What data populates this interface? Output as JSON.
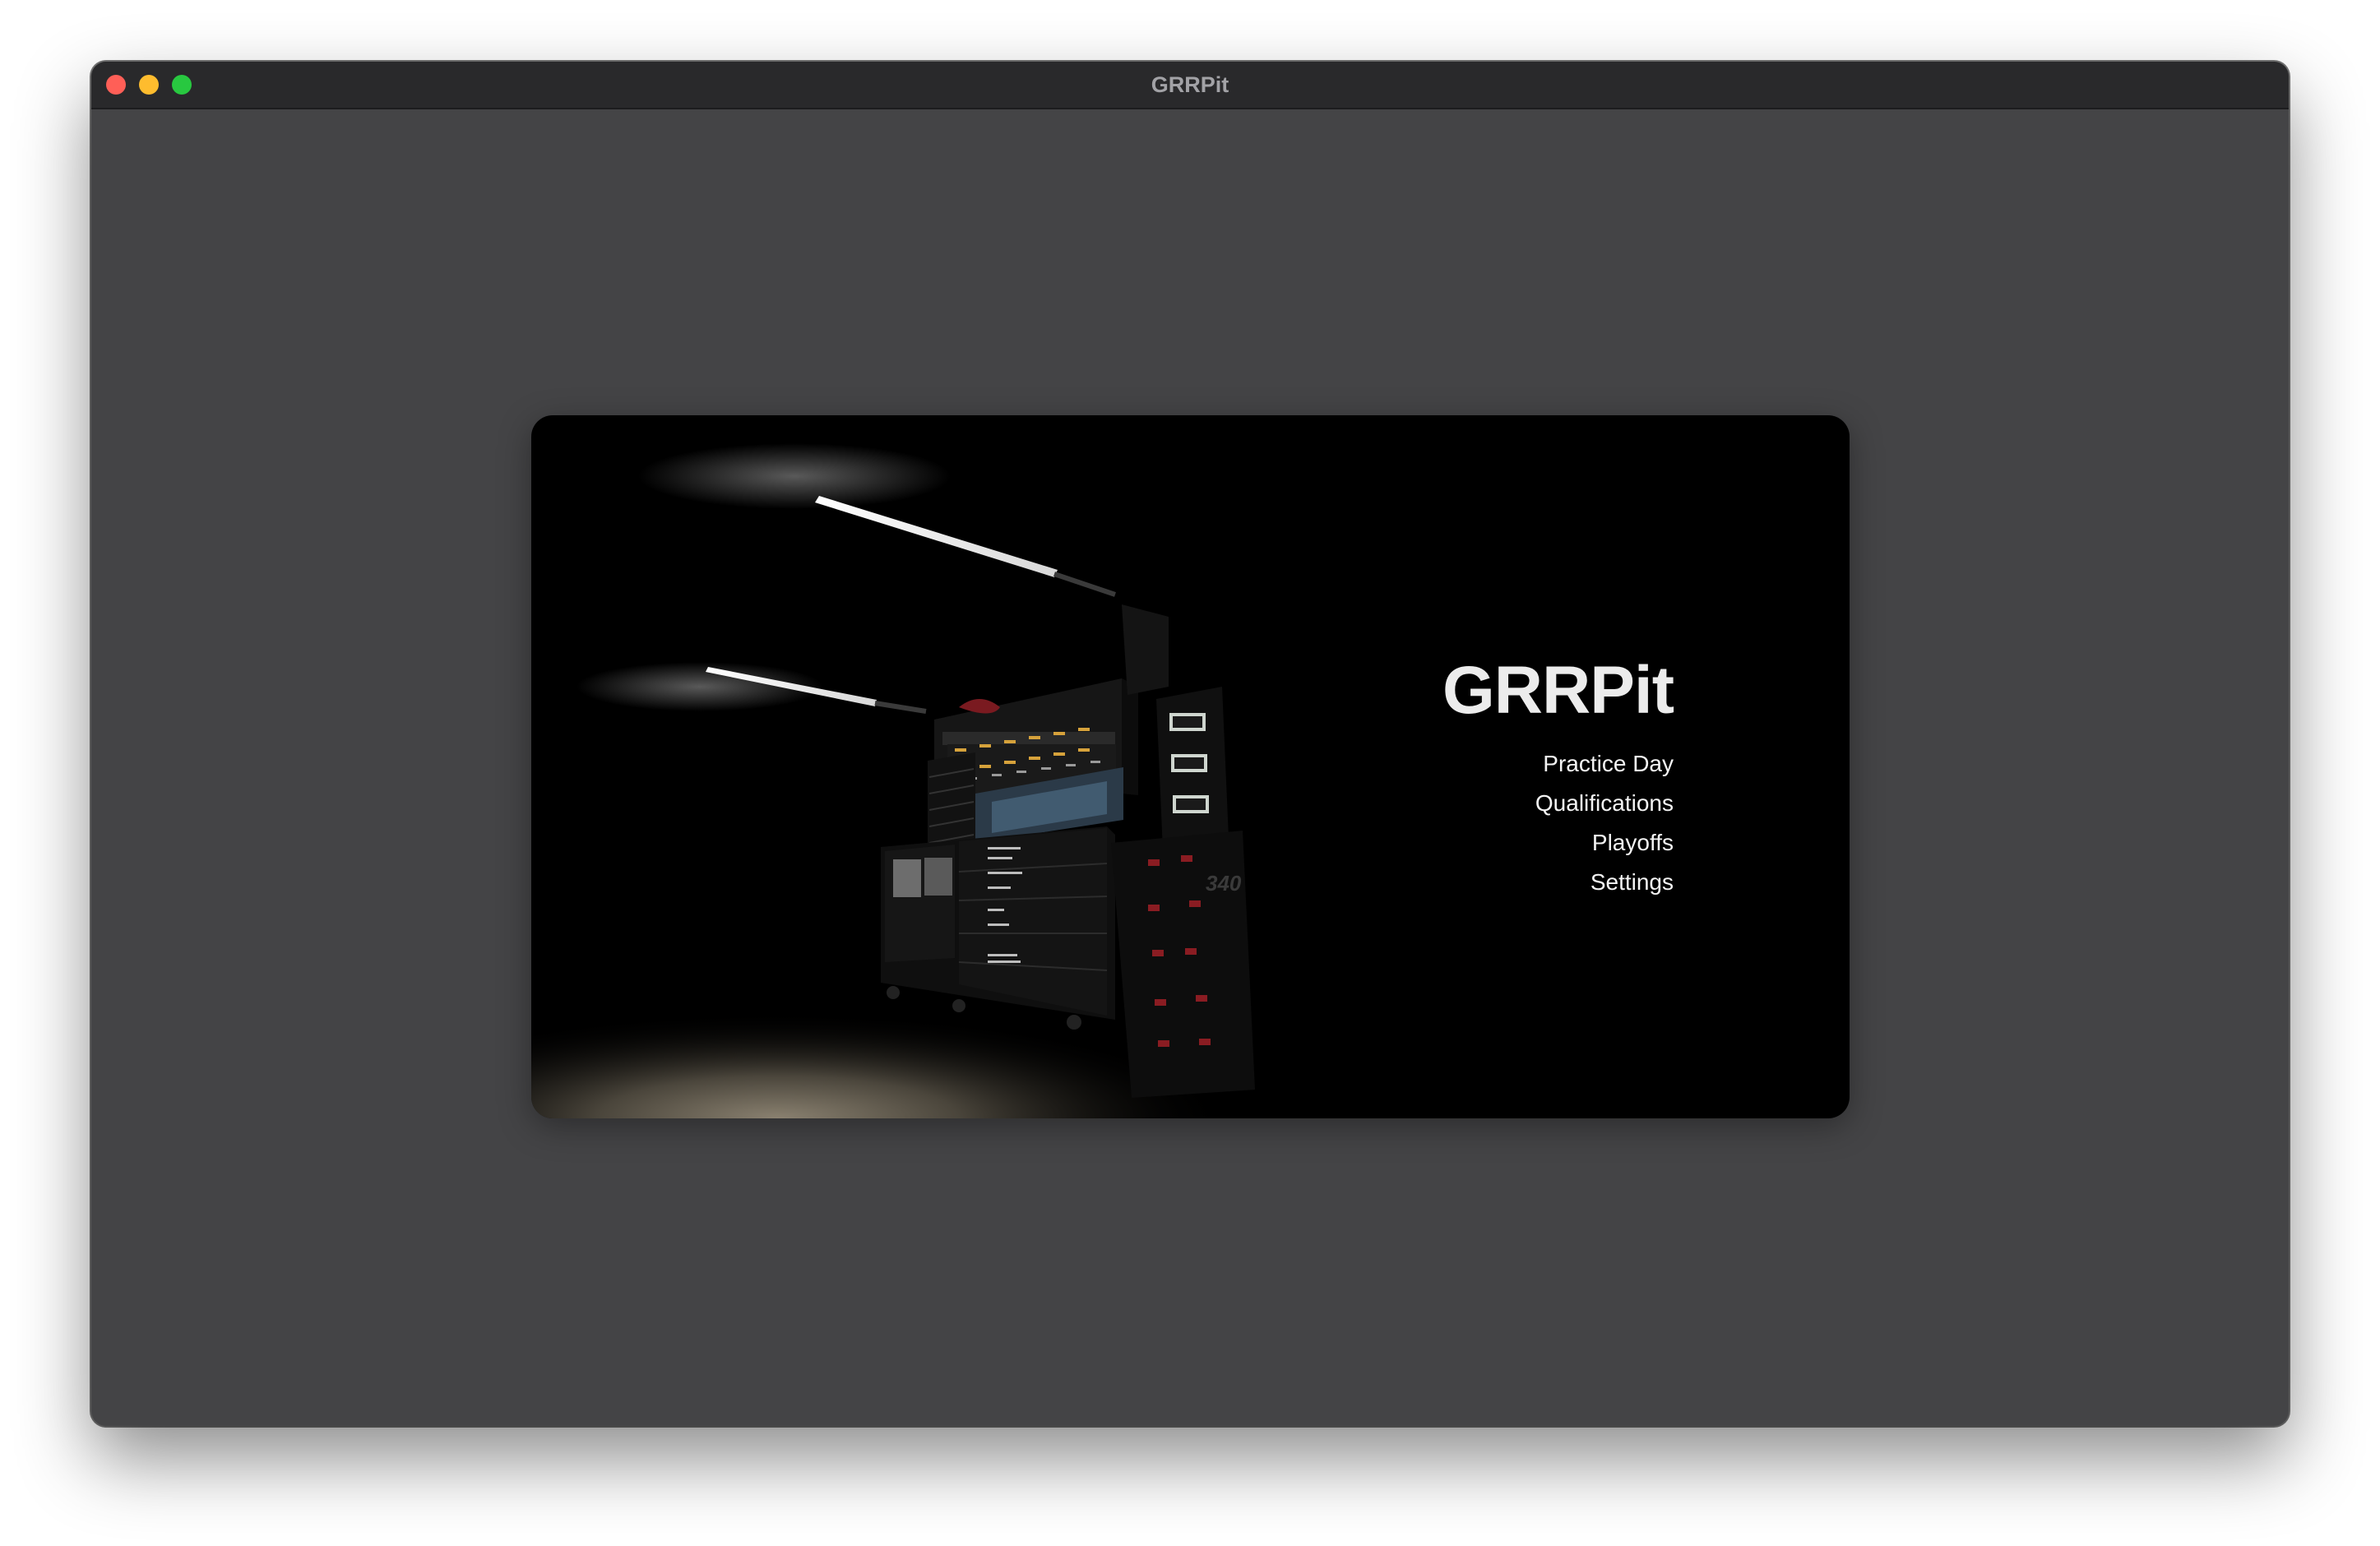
{
  "window": {
    "title": "GRRPit"
  },
  "app": {
    "title": "GRRPit",
    "menu": [
      {
        "label": "Practice Day"
      },
      {
        "label": "Qualifications"
      },
      {
        "label": "Playoffs"
      },
      {
        "label": "Settings"
      }
    ]
  },
  "hero_image": {
    "scale_number": "340"
  },
  "colors": {
    "window_bg": "#444446",
    "titlebar_bg": "#29292b",
    "card_bg": "#000000",
    "close": "#ff5f57",
    "minimize": "#febc2e",
    "zoom": "#28c840"
  }
}
